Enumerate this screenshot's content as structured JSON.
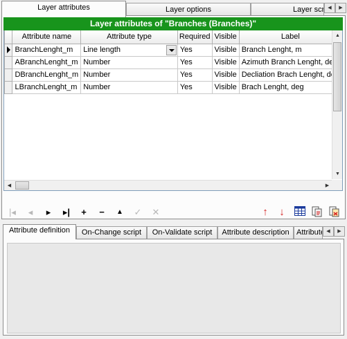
{
  "tabs": [
    {
      "label": "Layer attributes",
      "active": true
    },
    {
      "label": "Layer options",
      "active": false
    },
    {
      "label": "Layer scripts",
      "active": false
    }
  ],
  "banner": "Layer attributes of \"Branches (Branches)\"",
  "columns": [
    "Attribute name",
    "Attribute type",
    "Required",
    "Visible",
    "Label"
  ],
  "rows": [
    {
      "name": "BranchLenght_m",
      "type": "Line length",
      "required": "Yes",
      "visible": "Visible",
      "label": "Branch Lenght, m"
    },
    {
      "name": "ABranchLenght_m",
      "type": "Number",
      "required": "Yes",
      "visible": "Visible",
      "label": "Azimuth Branch Lenght, deg"
    },
    {
      "name": "DBranchLenght_m",
      "type": "Number",
      "required": "Yes",
      "visible": "Visible",
      "label": "Decliation Brach Lenght, deg"
    },
    {
      "name": "LBranchLenght_m",
      "type": "Number",
      "required": "Yes",
      "visible": "Visible",
      "label": "Brach Lenght, deg"
    }
  ],
  "toolbar": {
    "first": "|◂",
    "prior": "◂",
    "next": "▸",
    "last": "▸|",
    "insert": "+",
    "delete": "−",
    "edit": "▲",
    "post": "✓",
    "cancel": "✕",
    "move_up": "↑",
    "move_down": "↓",
    "colors": {
      "red": "#d42020",
      "blue": "#1a3a9c"
    }
  },
  "bottom_tabs": [
    {
      "label": "Attribute definition",
      "active": true
    },
    {
      "label": "On-Change script",
      "active": false
    },
    {
      "label": "On-Validate script",
      "active": false
    },
    {
      "label": "Attribute description",
      "active": false
    },
    {
      "label": "Attribute",
      "active": false
    }
  ]
}
